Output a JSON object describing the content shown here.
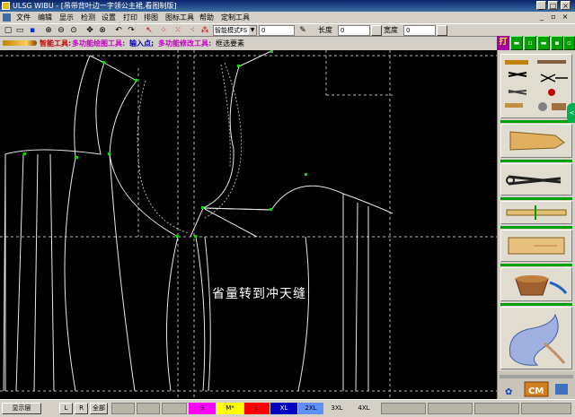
{
  "window": {
    "title": "ULSG WIBU - [吊带背叶边一字领公主裙,看图制版]",
    "minimize_glyph": "_",
    "maximize_glyph": "□",
    "close_glyph": "×"
  },
  "menu": {
    "items": [
      "文件",
      "编辑",
      "显示",
      "检测",
      "设置",
      "打印",
      "排图",
      "图标工具",
      "帮助",
      "定制工具"
    ],
    "mdi_minimize": "_",
    "mdi_restore": "▫",
    "mdi_close": "×"
  },
  "toolbar": {
    "smart_mode_value": "智能模式FS",
    "field_zero_value": "0",
    "length_label": "长度",
    "length_value": "0",
    "width_label": "宽度",
    "width_value": "0"
  },
  "infobar": {
    "smart_tool_label": "智能工具:",
    "multi_draw_label": "多功能绘图工具:",
    "input_point_label": "输入点;",
    "multi_edit_label": "多功能修改工具:",
    "select_element_label": "框选要素"
  },
  "right_top_buttons": {
    "magenta_label": "打"
  },
  "canvas": {
    "annotation": "省量转到冲天缝",
    "line_color": "#e8e8e8",
    "grid_color": "#b0b0b0",
    "point_color": "#00e000"
  },
  "side_tab_label": "<",
  "statusbar": {
    "display_layer_label": "显示层",
    "l_label": "L",
    "r_label": "R",
    "all_label": "全部",
    "swatches": [
      {
        "label": "",
        "color": "#d4d0c8"
      },
      {
        "label": "S",
        "color": "#ff00ff"
      },
      {
        "label": "M*",
        "color": "#ffff00"
      },
      {
        "label": "L",
        "color": "#ff0000"
      },
      {
        "label": "XL",
        "color": "#0000c0"
      },
      {
        "label": "2XL",
        "color": "#6090ff"
      },
      {
        "label": "3XL",
        "color": "#d4d0c8"
      },
      {
        "label": "4XL",
        "color": "#d4d0c8"
      }
    ]
  }
}
